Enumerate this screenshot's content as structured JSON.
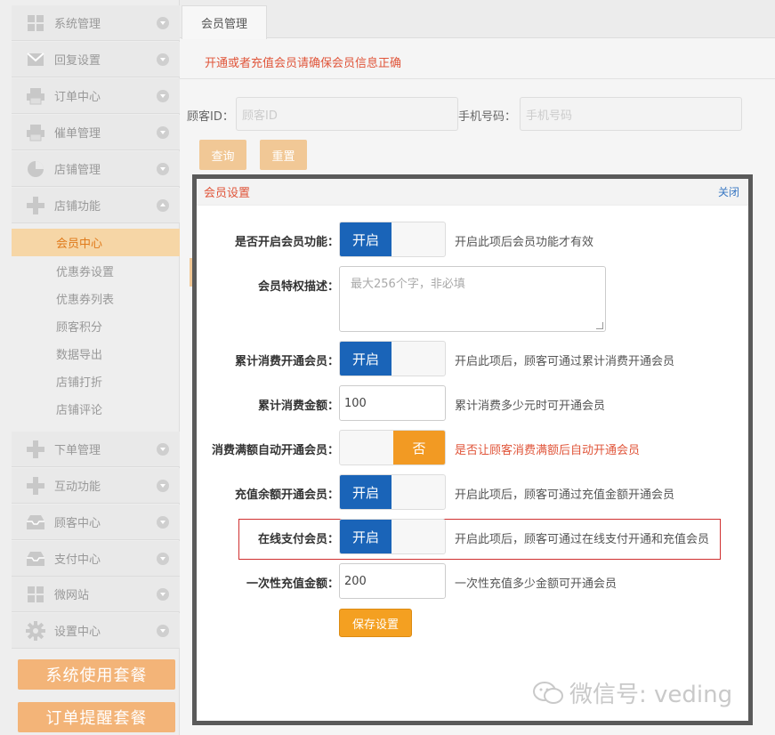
{
  "sidebar": {
    "menu": [
      {
        "label": "系统管理",
        "icon": "grid-icon"
      },
      {
        "label": "回复设置",
        "icon": "mail-icon"
      },
      {
        "label": "订单中心",
        "icon": "printer-icon"
      },
      {
        "label": "催单管理",
        "icon": "printer-icon"
      },
      {
        "label": "店铺管理",
        "icon": "pie-chart-icon"
      },
      {
        "label": "店铺功能",
        "icon": "plus-icon"
      }
    ],
    "submenu": [
      "会员中心",
      "优惠券设置",
      "优惠券列表",
      "顾客积分",
      "数据导出",
      "店铺打折",
      "店铺评论"
    ],
    "menu2": [
      {
        "label": "下单管理",
        "icon": "plus-icon"
      },
      {
        "label": "互动功能",
        "icon": "plus-icon"
      },
      {
        "label": "顾客中心",
        "icon": "inbox-icon"
      },
      {
        "label": "支付中心",
        "icon": "inbox-icon"
      },
      {
        "label": "微网站",
        "icon": "grid-icon"
      },
      {
        "label": "设置中心",
        "icon": "gear-icon"
      }
    ],
    "package_buttons": [
      "系统使用套餐",
      "订单提醒套餐"
    ]
  },
  "main": {
    "tab": "会员管理",
    "notice": "开通或者充值会员请确保会员信息正确",
    "filters": {
      "customer_id_label": "顾客ID：",
      "customer_id_placeholder": "顾客ID",
      "phone_label": "手机号码：",
      "phone_placeholder": "手机号码"
    },
    "query_button": "查询",
    "reset_button": "重置"
  },
  "modal": {
    "title": "会员设置",
    "close": "关闭",
    "rows": {
      "enable": {
        "label": "是否开启会员功能：",
        "state": "开启",
        "hint": "开启此项后会员功能才有效"
      },
      "desc": {
        "label": "会员特权描述：",
        "placeholder": "最大256个字，非必填"
      },
      "cumulative": {
        "label": "累计消费开通会员：",
        "state": "开启",
        "hint": "开启此项后，顾客可通过累计消费开通会员"
      },
      "cumulative_amount": {
        "label": "累计消费金额：",
        "value": "100",
        "hint": "累计消费多少元时可开通会员"
      },
      "auto_open": {
        "label": "消费满额自动开通会员：",
        "state": "否",
        "hint": "是否让顾客消费满额后自动开通会员"
      },
      "recharge": {
        "label": "充值余额开通会员：",
        "state": "开启",
        "hint": "开启此项后，顾客可通过充值金额开通会员"
      },
      "online_pay": {
        "label": "在线支付会员：",
        "state": "开启",
        "hint": "开启此项后，顾客可通过在线支付开通和充值会员"
      },
      "one_time": {
        "label": "一次性充值金额：",
        "value": "200",
        "hint": "一次性充值多少金额可开通会员"
      }
    },
    "save": "保存设置"
  },
  "watermark": "微信号: veding",
  "colors": {
    "accent_orange": "#f29a23",
    "toggle_blue": "#1a64b8",
    "notice_red": "#e0553a",
    "active_bg": "#f6d6a6"
  }
}
